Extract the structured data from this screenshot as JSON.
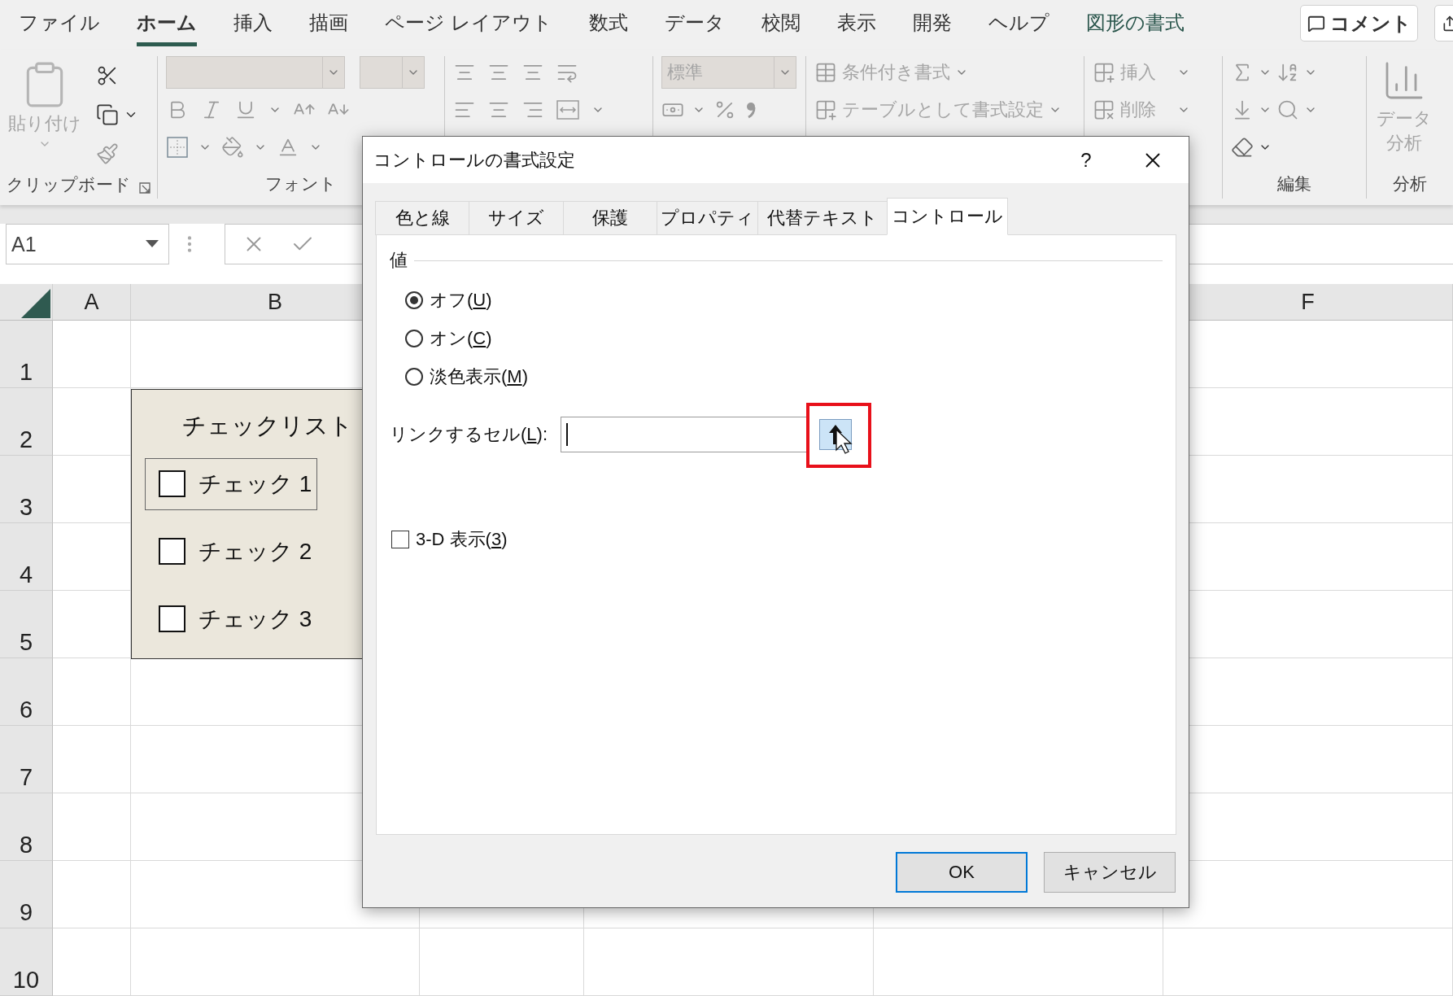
{
  "menu_tabs": [
    {
      "label": "ファイル",
      "selected": false,
      "kind": "tab"
    },
    {
      "label": "ホーム",
      "selected": true,
      "kind": "tab"
    },
    {
      "label": "挿入",
      "selected": false,
      "kind": "tab"
    },
    {
      "label": "描画",
      "selected": false,
      "kind": "tab"
    },
    {
      "label": "ページ レイアウト",
      "selected": false,
      "kind": "tab"
    },
    {
      "label": "数式",
      "selected": false,
      "kind": "tab"
    },
    {
      "label": "データ",
      "selected": false,
      "kind": "tab"
    },
    {
      "label": "校閲",
      "selected": false,
      "kind": "tab"
    },
    {
      "label": "表示",
      "selected": false,
      "kind": "tab"
    },
    {
      "label": "開発",
      "selected": false,
      "kind": "tab"
    },
    {
      "label": "ヘルプ",
      "selected": false,
      "kind": "tab"
    },
    {
      "label": "図形の書式",
      "selected": false,
      "kind": "context"
    }
  ],
  "comment_button": {
    "label": "コメント"
  },
  "ribbon": {
    "clipboard": {
      "label": "クリップボード",
      "paste": {
        "label": "貼り付け",
        "disabled": true
      }
    },
    "font": {
      "label": "フォント"
    },
    "number": {
      "format": {
        "value": "標準",
        "disabled": true
      }
    },
    "styles": {
      "items": [
        {
          "label": "条件付き書式",
          "disabled": true
        },
        {
          "label": "テーブルとして書式設定",
          "disabled": true
        }
      ]
    },
    "cells": {
      "items": [
        {
          "label": "挿入",
          "disabled": true
        },
        {
          "label": "削除",
          "disabled": true
        }
      ]
    },
    "editing": {
      "label": "編集"
    },
    "analysis": {
      "label": "分析",
      "button": {
        "label": "データ分析",
        "disabled": true
      }
    }
  },
  "name_box": {
    "value": "A1"
  },
  "column_headers": [
    {
      "label": "A"
    },
    {
      "label": "B"
    },
    {
      "label": "F"
    }
  ],
  "row_headers": [
    "1",
    "2",
    "3",
    "4",
    "5",
    "6",
    "7",
    "8",
    "9",
    "10"
  ],
  "checklist": {
    "title": "チェックリスト",
    "items": [
      {
        "label": "チェック 1",
        "checked": false,
        "selected": true
      },
      {
        "label": "チェック 2",
        "checked": false,
        "selected": false
      },
      {
        "label": "チェック 3",
        "checked": false,
        "selected": false
      }
    ]
  },
  "dialog": {
    "title": "コントロールの書式設定",
    "help": "?",
    "tabs": [
      {
        "label": "色と線",
        "selected": false
      },
      {
        "label": "サイズ",
        "selected": false
      },
      {
        "label": "保護",
        "selected": false
      },
      {
        "label": "プロパティ",
        "selected": false
      },
      {
        "label": "代替テキスト",
        "selected": false
      },
      {
        "label": "コントロール",
        "selected": true
      }
    ],
    "section": "値",
    "value_options": [
      {
        "label": [
          "オフ(",
          "U",
          ")"
        ],
        "selected": true
      },
      {
        "label": [
          "オン(",
          "C",
          ")"
        ],
        "selected": false
      },
      {
        "label": [
          "淡色表示(",
          "M",
          ")"
        ],
        "selected": false
      }
    ],
    "link_cell": {
      "label": [
        "リンクするセル(",
        "L",
        "):"
      ],
      "ref_button_highlighted": true
    },
    "three_d": {
      "label": [
        "3-D 表示(",
        "3",
        ")"
      ],
      "checked": false
    },
    "buttons": [
      {
        "label": "OK",
        "kind": "default"
      },
      {
        "label": "キャンセル",
        "kind": "normal"
      }
    ]
  }
}
